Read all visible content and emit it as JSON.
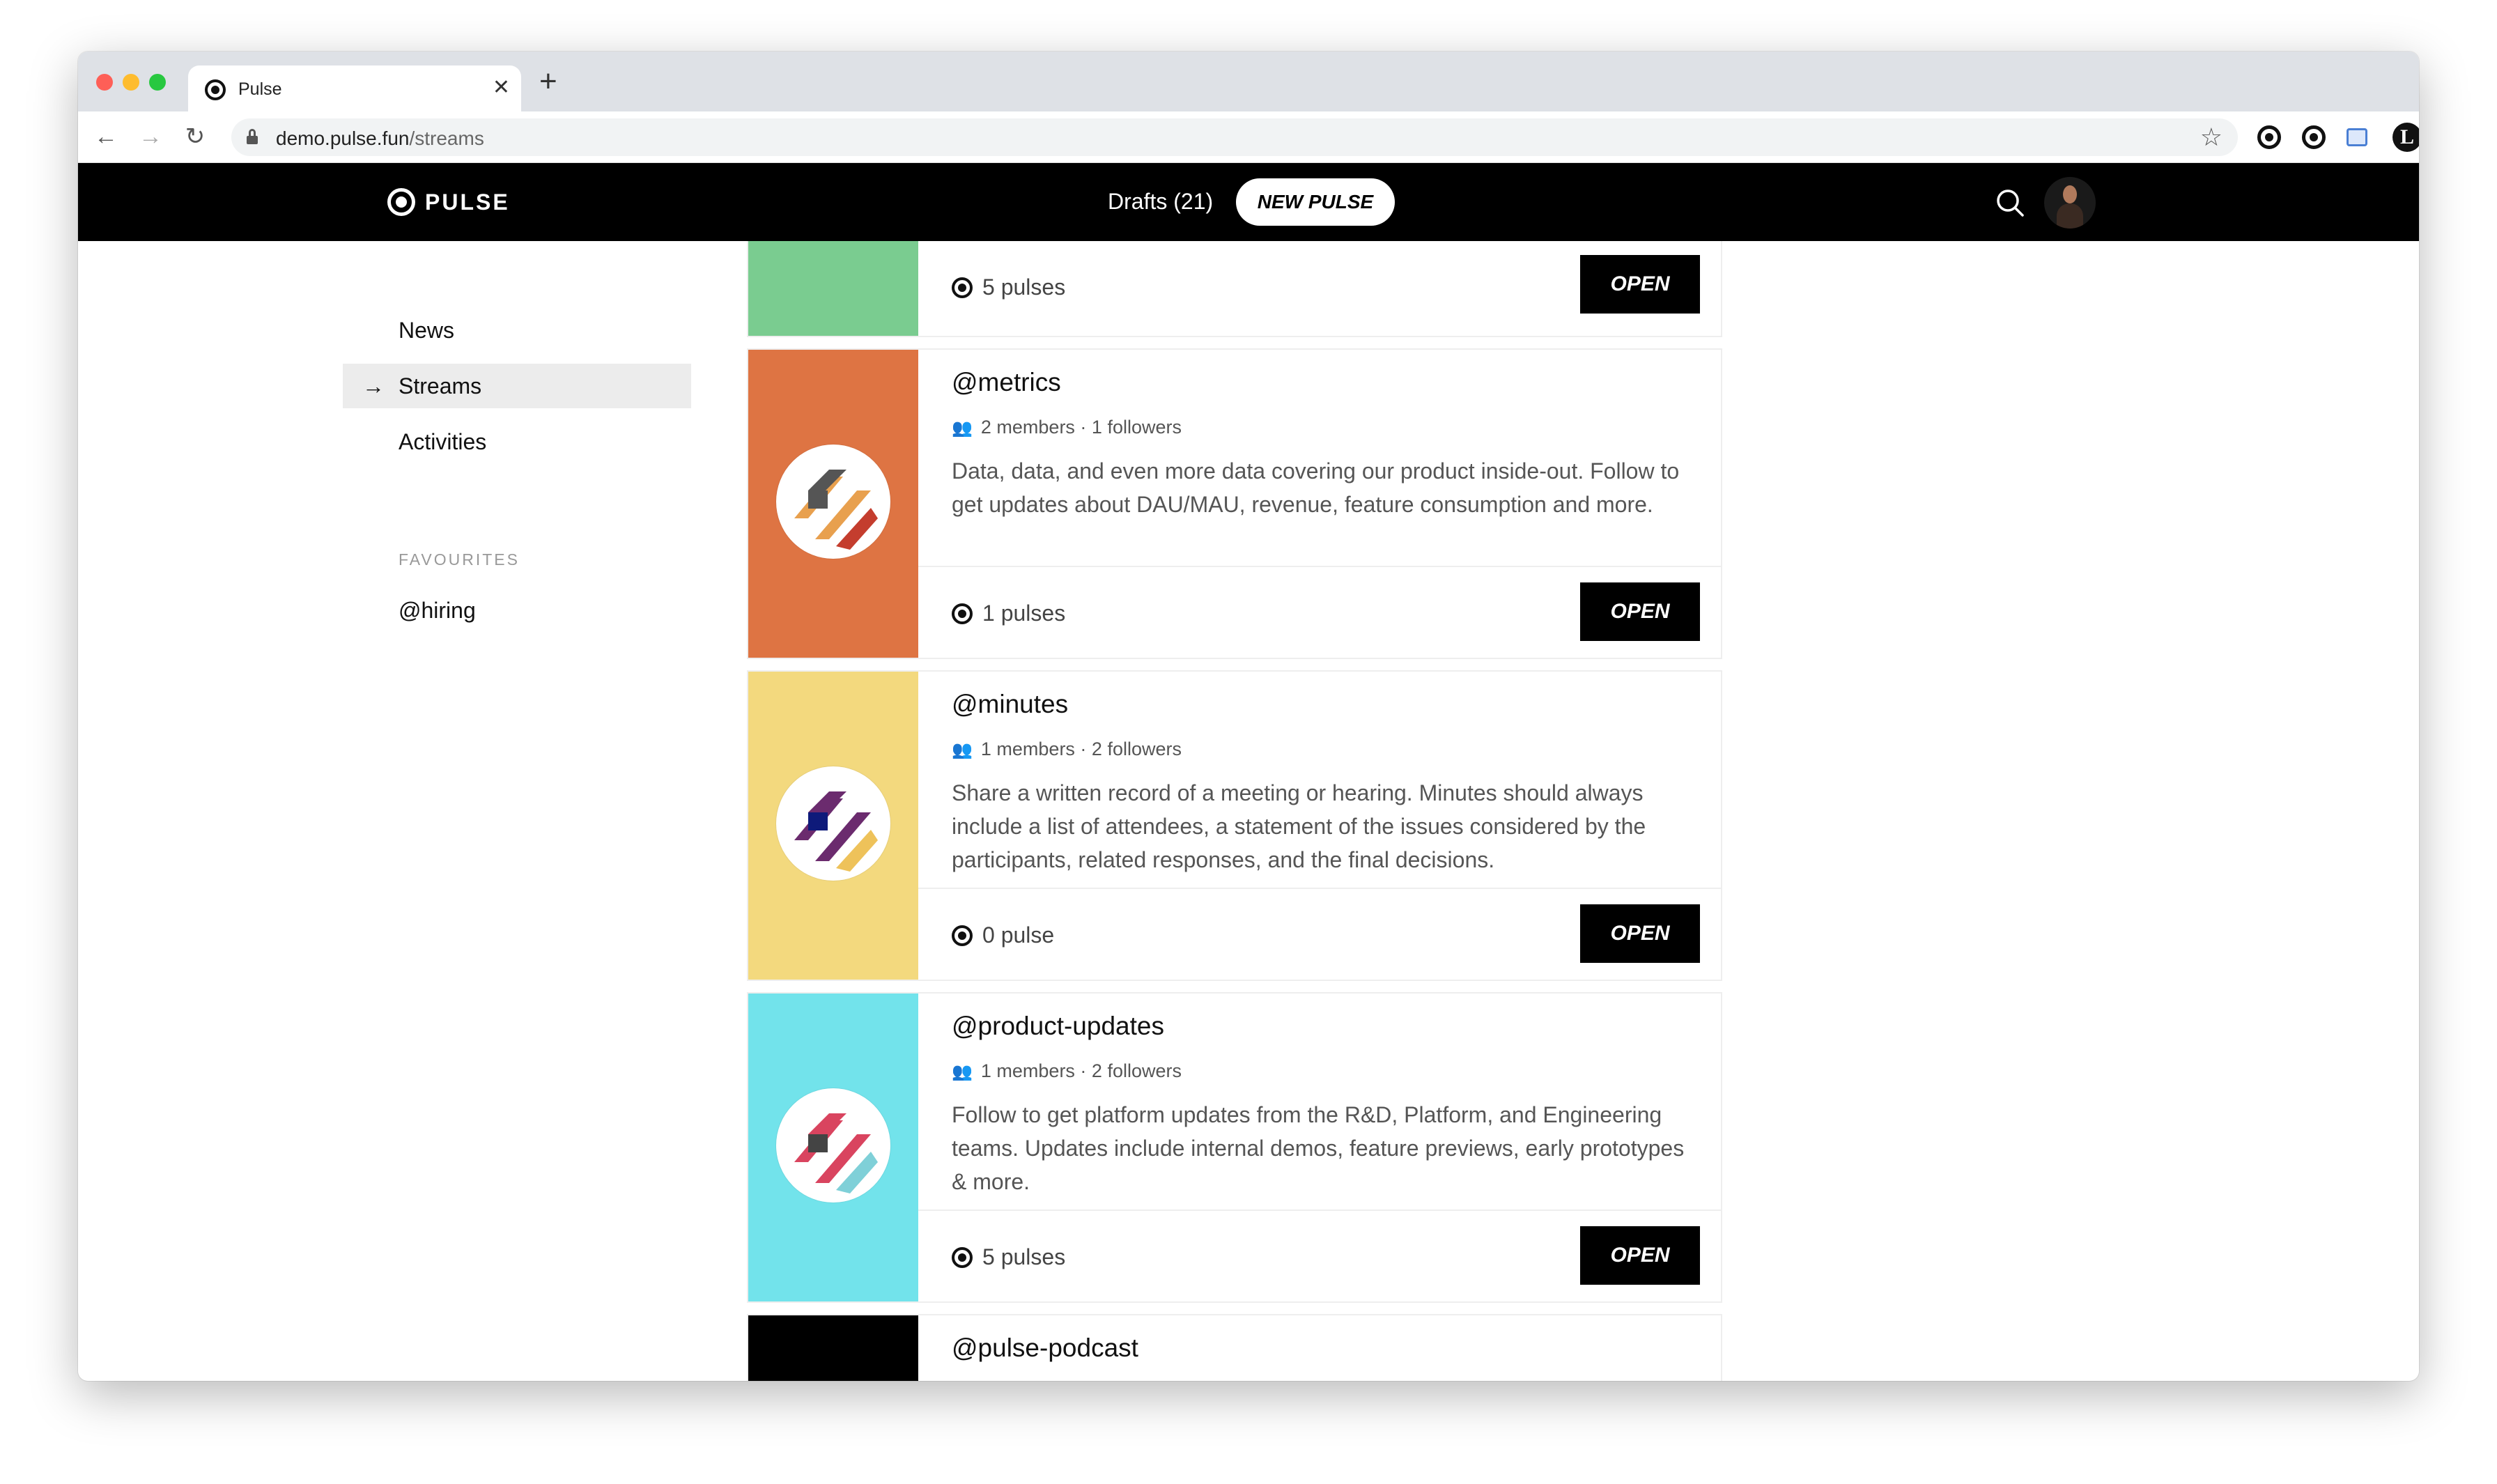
{
  "browser": {
    "tab_title": "Pulse",
    "url_host": "demo.pulse.fun",
    "url_path": "/streams",
    "ext_avatar_letter": "L"
  },
  "header": {
    "logo_text": "PULSE",
    "drafts_label": "Drafts (21)",
    "new_pulse_label": "NEW PULSE"
  },
  "sidebar": {
    "items": [
      {
        "label": "News"
      },
      {
        "label": "Streams",
        "active": true
      },
      {
        "label": "Activities"
      }
    ],
    "favourites_heading": "FAVOURITES",
    "favourites": [
      {
        "label": "@hiring"
      }
    ]
  },
  "streams": [
    {
      "cover_color": "#7acc90",
      "pulses": "5 pulses",
      "open_label": "OPEN"
    },
    {
      "name": "@metrics",
      "cover_color": "#de7443",
      "meta": "2 members · 1 followers",
      "description": "Data, data, and even more data covering our product inside-out. Follow to get updates about DAU/MAU, revenue, feature consumption and more.",
      "pulses": "1 pulses",
      "open_label": "OPEN",
      "avatar_colors": [
        "#e8a04e",
        "#c43d2e",
        "#555555"
      ]
    },
    {
      "name": "@minutes",
      "cover_color": "#f3d97e",
      "meta": "1 members · 2 followers",
      "description": "Share a written record of a meeting or hearing. Minutes should always include a list of attendees, a statement of the issues considered by the participants, related responses, and the final decisions.",
      "pulses": "0 pulse",
      "open_label": "OPEN",
      "avatar_colors": [
        "#6b2b6e",
        "#eec25a",
        "#0e1a7a"
      ]
    },
    {
      "name": "@product-updates",
      "cover_color": "#72e3eb",
      "meta": "1 members · 2 followers",
      "description": "Follow to get platform updates from the R&D, Platform, and Engineering teams. Updates include internal demos, feature previews, early prototypes & more.",
      "pulses": "5 pulses",
      "open_label": "OPEN",
      "avatar_colors": [
        "#d9445f",
        "#7fd0d8",
        "#444444"
      ]
    },
    {
      "name": "@pulse-podcast",
      "cover_color": "#000000"
    }
  ]
}
